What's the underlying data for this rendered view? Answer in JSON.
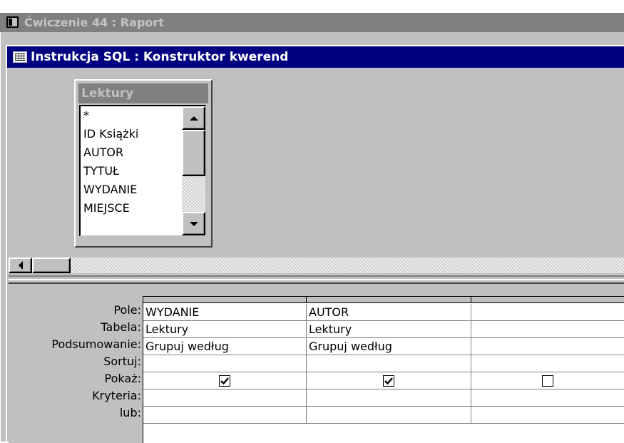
{
  "outer_window": {
    "title": "Ćwiczenie 44 : Raport"
  },
  "inner_window": {
    "title": "Instrukcja SQL : Konstruktor kwerend"
  },
  "field_list": {
    "title": "Lektury",
    "items": [
      "*",
      "ID Książki",
      "AUTOR",
      "TYTUŁ",
      "WYDANIE",
      "MIEJSCE"
    ]
  },
  "grid": {
    "row_labels": [
      "Pole:",
      "Tabela:",
      "Podsumowanie:",
      "Sortuj:",
      "Pokaż:",
      "Kryteria:",
      "lub:"
    ],
    "columns": [
      {
        "field": "WYDANIE",
        "table": "Lektury",
        "total": "Grupuj według",
        "sort": "",
        "show": true,
        "criteria": "",
        "or": ""
      },
      {
        "field": "AUTOR",
        "table": "Lektury",
        "total": "Grupuj według",
        "sort": "",
        "show": true,
        "criteria": "",
        "or": ""
      },
      {
        "field": "",
        "table": "",
        "total": "",
        "sort": "",
        "show": false,
        "criteria": "",
        "or": ""
      }
    ]
  },
  "colors": {
    "active_title": "#000080",
    "inactive_title": "#808080",
    "face": "#c0c0c0"
  }
}
